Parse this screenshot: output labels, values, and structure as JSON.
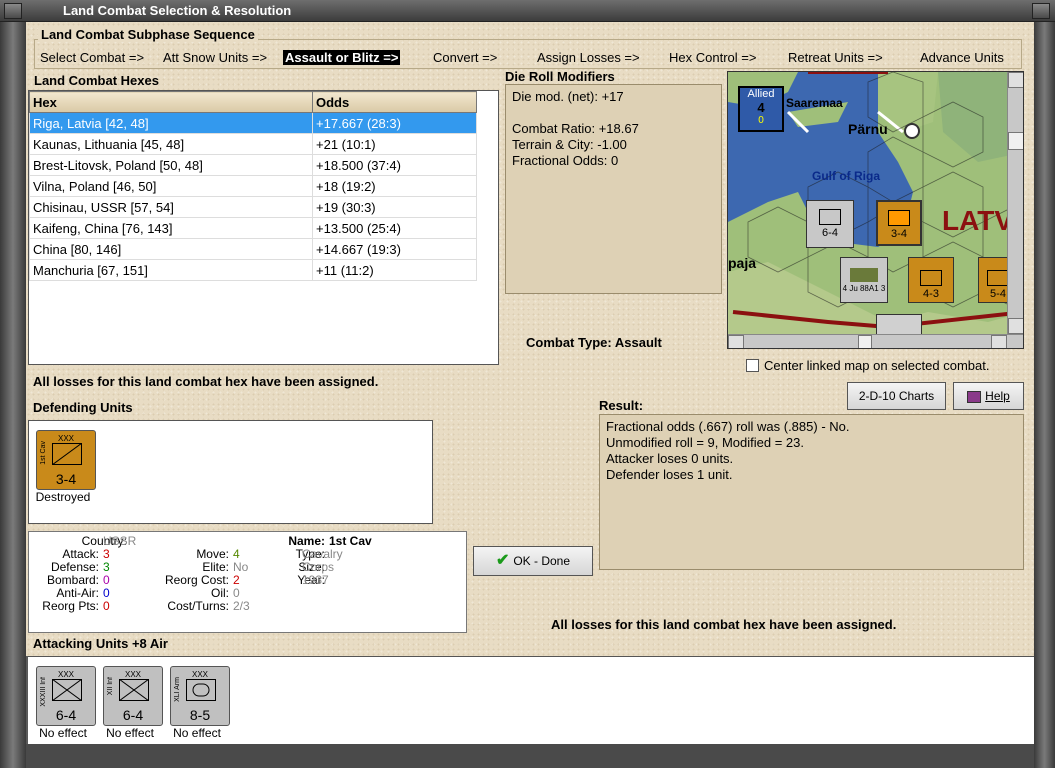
{
  "window": {
    "title": "Land Combat Selection & Resolution"
  },
  "subphase": {
    "title": "Land Combat Subphase Sequence",
    "steps": [
      "Select Combat =>",
      "Att Snow Units =>",
      "Assault or Blitz =>",
      "Convert =>",
      "Assign Losses =>",
      "Hex Control =>",
      "Retreat Units =>",
      "Advance Units"
    ],
    "active_index": 2
  },
  "hexes": {
    "title": "Land Combat Hexes",
    "columns": [
      "Hex",
      "Odds"
    ],
    "rows": [
      [
        "Riga, Latvia [42, 48]",
        "+17.667 (28:3)"
      ],
      [
        "Kaunas, Lithuania [45, 48]",
        "+21 (10:1)"
      ],
      [
        "Brest-Litovsk, Poland [50, 48]",
        "+18.500 (37:4)"
      ],
      [
        "Vilna, Poland [46, 50]",
        "+18 (19:2)"
      ],
      [
        "Chisinau, USSR [57, 54]",
        "+19 (30:3)"
      ],
      [
        "Kaifeng, China [76, 143]",
        "+13.500 (25:4)"
      ],
      [
        "China [80, 146]",
        "+14.667 (19:3)"
      ],
      [
        "Manchuria [67, 151]",
        "+11 (11:2)"
      ]
    ],
    "selected_index": 0
  },
  "modifiers": {
    "title": "Die Roll Modifiers",
    "lines": [
      "Die mod. (net): +17",
      "",
      "Combat Ratio: +18.67",
      "Terrain & City: -1.00",
      "Fractional Odds: 0"
    ]
  },
  "map": {
    "allied_label": "Allied",
    "allied_count": "4",
    "allied_sub": "0",
    "places": [
      "Saaremaa",
      "Pärnu",
      "Gulf of Riga",
      "LATV",
      "paja"
    ],
    "units": [
      "6-4",
      "3-4",
      "4-3",
      "5-4"
    ],
    "air_unit": "4 Ju 88A1 3",
    "center_label": "Center linked map on selected combat."
  },
  "combat_type": {
    "label": "Combat Type:",
    "value": "Assault"
  },
  "losses_msg": "All losses for this land combat hex have been assigned.",
  "defending": {
    "title": "Defending Units",
    "units": [
      {
        "name": "1st Cav",
        "strength": "3-4",
        "status": "Destroyed",
        "size": "XXX"
      }
    ]
  },
  "unit_info": {
    "country_label": "Country:",
    "country": "USSR",
    "attack_label": "Attack:",
    "attack": "3",
    "defense_label": "Defense:",
    "defense": "3",
    "bombard_label": "Bombard:",
    "bombard": "0",
    "antiair_label": "Anti-Air:",
    "antiair": "0",
    "reorg_pts_label": "Reorg Pts:",
    "reorg_pts": "0",
    "move_label": "Move:",
    "move": "4",
    "elite_label": "Elite:",
    "elite": "No",
    "reorg_cost_label": "Reorg Cost:",
    "reorg_cost": "2",
    "oil_label": "Oil:",
    "oil": "0",
    "cost_turns_label": "Cost/Turns:",
    "cost_turns": "2/3",
    "name_label": "Name:",
    "name": "1st Cav",
    "type_label": "Type:",
    "type": "Cavalry",
    "size_label": "Size:",
    "size": "Corps",
    "year_label": "Year:",
    "year": "1937"
  },
  "buttons": {
    "charts": "2-D-10 Charts",
    "help": "Help",
    "ok": "OK - Done"
  },
  "result": {
    "title": "Result:",
    "lines": [
      "Fractional odds (.667) roll was (.885)  - No.",
      "Unmodified roll = 9, Modified = 23.",
      "Attacker loses 0 units.",
      "Defender loses 1 unit."
    ]
  },
  "attacking": {
    "title": "Attacking Units +8 Air",
    "units": [
      {
        "name": "XXXIII Inf",
        "strength": "6-4",
        "status": "No effect",
        "size": "XXX"
      },
      {
        "name": "XII Inf",
        "strength": "6-4",
        "status": "No effect",
        "size": "XXX"
      },
      {
        "name": "XLI Arm",
        "strength": "8-5",
        "status": "No effect",
        "size": "XXX"
      }
    ]
  },
  "colors": {
    "selection": "#3399ee",
    "cavalry_counter": "#c98a1a",
    "german_counter": "#b8b8b8",
    "attack_val": "#cc0000",
    "defense_val": "#008800",
    "bombard_val": "#aa00aa",
    "antiair_val": "#0000cc"
  }
}
